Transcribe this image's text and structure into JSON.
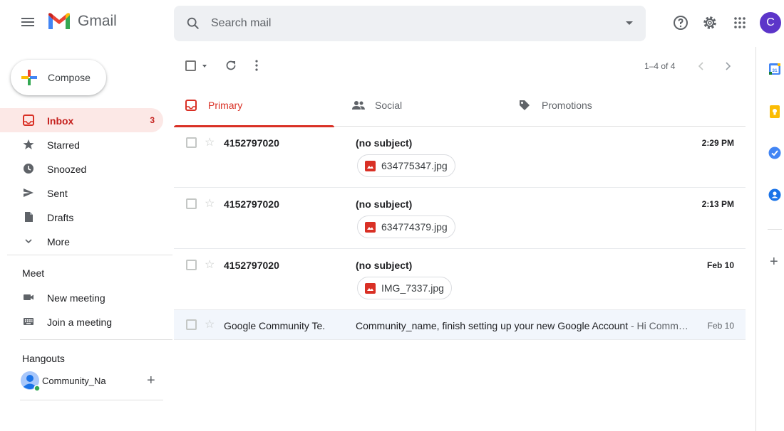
{
  "header": {
    "app_name": "Gmail",
    "search_placeholder": "Search mail",
    "avatar_initial": "C"
  },
  "compose": {
    "label": "Compose"
  },
  "nav": {
    "items": [
      {
        "label": "Inbox",
        "count": "3",
        "icon": "inbox-icon",
        "active": true
      },
      {
        "label": "Starred",
        "icon": "star-icon"
      },
      {
        "label": "Snoozed",
        "icon": "clock-icon"
      },
      {
        "label": "Sent",
        "icon": "send-icon"
      },
      {
        "label": "Drafts",
        "icon": "draft-icon"
      },
      {
        "label": "More",
        "icon": "chevron-down-icon"
      }
    ]
  },
  "meet": {
    "title": "Meet",
    "items": [
      {
        "label": "New meeting",
        "icon": "video-icon"
      },
      {
        "label": "Join a meeting",
        "icon": "keyboard-icon"
      }
    ]
  },
  "hangouts": {
    "title": "Hangouts",
    "user": "Community_Na"
  },
  "toolbar": {
    "paging": "1–4 of 4"
  },
  "tabs": [
    {
      "label": "Primary",
      "icon": "inbox-icon",
      "active": true
    },
    {
      "label": "Social",
      "icon": "people-icon"
    },
    {
      "label": "Promotions",
      "icon": "tag-icon"
    }
  ],
  "emails": [
    {
      "sender": "4152797020",
      "subject": "(no subject)",
      "time": "2:29 PM",
      "attachment": "634775347.jpg",
      "unread": true
    },
    {
      "sender": "4152797020",
      "subject": "(no subject)",
      "time": "2:13 PM",
      "attachment": "634774379.jpg",
      "unread": true
    },
    {
      "sender": "4152797020",
      "subject": "(no subject)",
      "time": "Feb 10",
      "attachment": "IMG_7337.jpg",
      "unread": true
    },
    {
      "sender": "Google Community Te.",
      "subject": "Community_name, finish setting up your new Google Account",
      "snippet": " - Hi Comm…",
      "time": "Feb 10",
      "unread": false
    }
  ],
  "colors": {
    "accent_red": "#d93025",
    "inbox_active_bg": "#fce8e6",
    "avatar_bg": "#5c35c9",
    "read_row_bg": "#f2f6fc"
  }
}
